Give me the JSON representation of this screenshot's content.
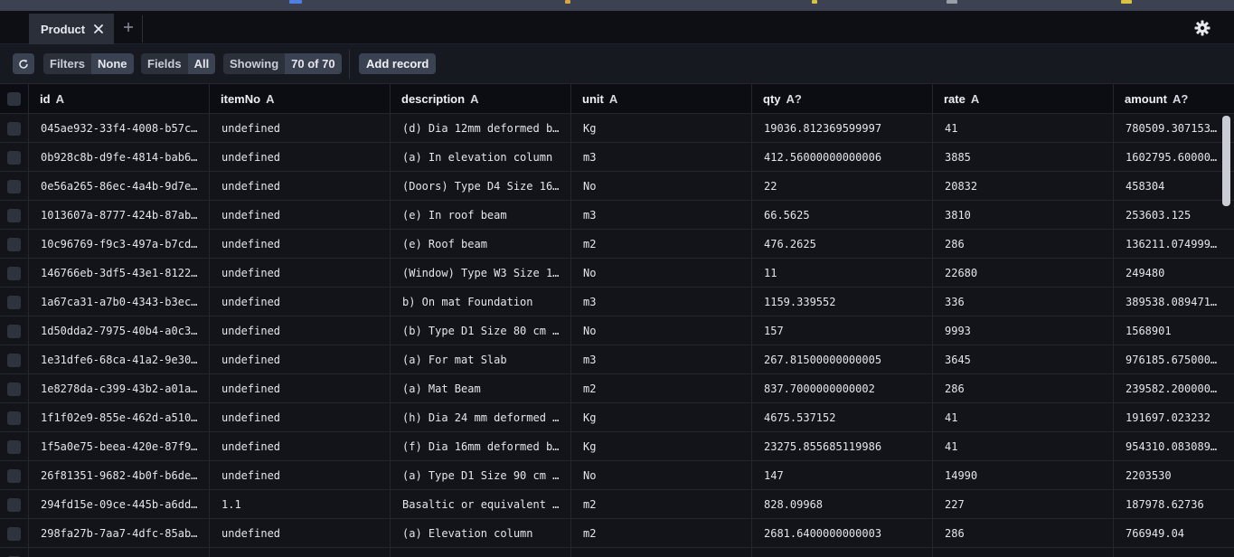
{
  "tab": {
    "label": "Product",
    "close_icon": "close-icon",
    "add_icon": "plus-icon"
  },
  "toolbar": {
    "refresh_icon": "refresh-icon",
    "filters_label": "Filters",
    "filters_value": "None",
    "fields_label": "Fields",
    "fields_value": "All",
    "showing_label": "Showing",
    "showing_value": "70 of 70",
    "add_record": "Add record"
  },
  "settings_icon": "gear-icon",
  "columns": [
    {
      "name": "id",
      "type": "A"
    },
    {
      "name": "itemNo",
      "type": "A"
    },
    {
      "name": "description",
      "type": "A"
    },
    {
      "name": "unit",
      "type": "A"
    },
    {
      "name": "qty",
      "type": "A?"
    },
    {
      "name": "rate",
      "type": "A"
    },
    {
      "name": "amount",
      "type": "A?"
    }
  ],
  "rows": [
    [
      "045ae932-33f4-4008-b57c…",
      "undefined",
      "(d) Dia 12mm deformed b…",
      "Kg",
      "19036.812369599997",
      "41",
      "780509.3071535999"
    ],
    [
      "0b928c8b-d9fe-4814-bab6…",
      "undefined",
      "(a) In elevation column",
      "m3",
      "412.56000000000006",
      "3885",
      "1602795.6000000002"
    ],
    [
      "0e56a265-86ec-4a4b-9d7e…",
      "undefined",
      "(Doors) Type D4 Size 16…",
      "No",
      "22",
      "20832",
      "458304"
    ],
    [
      "1013607a-8777-424b-87ab…",
      "undefined",
      "(e) In roof beam",
      "m3",
      "66.5625",
      "3810",
      "253603.125"
    ],
    [
      "10c96769-f9c3-497a-b7cd…",
      "undefined",
      "(e) Roof beam",
      "m2",
      "476.2625",
      "286",
      "136211.07499999998"
    ],
    [
      "146766eb-3df5-43e1-8122…",
      "undefined",
      "(Window) Type W3 Size 1…",
      "No",
      "11",
      "22680",
      "249480"
    ],
    [
      "1a67ca31-a7b0-4343-b3ec…",
      "undefined",
      "b) On mat Foundation",
      "m3",
      "1159.339552",
      "336",
      "389538.089471999"
    ],
    [
      "1d50dda2-7975-40b4-a0c3…",
      "undefined",
      "(b) Type D1 Size 80 cm …",
      "No",
      "157",
      "9993",
      "1568901"
    ],
    [
      "1e31dfe6-68ca-41a2-9e30…",
      "undefined",
      "(a) For mat Slab",
      "m3",
      "267.81500000000005",
      "3645",
      "976185.6750000001"
    ],
    [
      "1e8278da-c399-43b2-a01a…",
      "undefined",
      "(a) Mat Beam",
      "m2",
      "837.7000000000002",
      "286",
      "239582.20000000004"
    ],
    [
      "1f1f02e9-855e-462d-a510…",
      "undefined",
      "(h) Dia 24 mm deformed …",
      "Kg",
      "4675.537152",
      "41",
      "191697.023232"
    ],
    [
      "1f5a0e75-beea-420e-87f9…",
      "undefined",
      "(f) Dia 16mm deformed b…",
      "Kg",
      "23275.855685119986",
      "41",
      "954310.0830899194"
    ],
    [
      "26f81351-9682-4b0f-b6de…",
      "undefined",
      "(a) Type D1 Size 90 cm …",
      "No",
      "147",
      "14990",
      "2203530"
    ],
    [
      "294fd15e-09ce-445b-a6dd…",
      "1.1",
      "Basaltic or equivalent …",
      "m2",
      "828.09968",
      "227",
      "187978.62736"
    ],
    [
      "298fa27b-7aa7-4dfc-85ab…",
      "undefined",
      "(a) Elevation column",
      "m2",
      "2681.6400000000003",
      "286",
      "766949.04"
    ],
    [
      "",
      "",
      "",
      "",
      "",
      "",
      ""
    ]
  ]
}
